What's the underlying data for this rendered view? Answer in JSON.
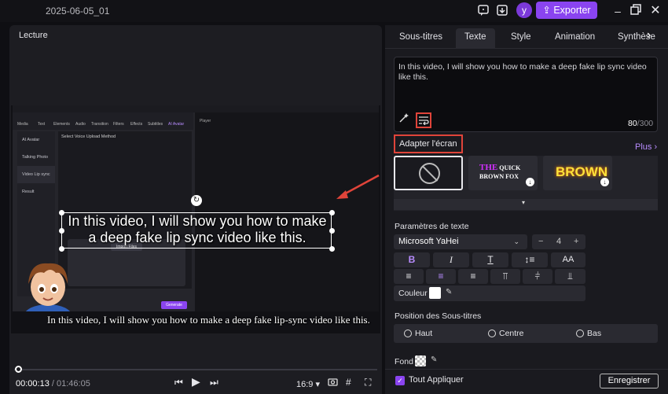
{
  "titlebar": {
    "date": "2025-06-05_01",
    "export_label": "Exporter",
    "avatar_letter": "y"
  },
  "left_panel": {
    "title": "Lecture"
  },
  "inner_app": {
    "toolbar_tabs": [
      "Media",
      "Text",
      "Elements",
      "Audio",
      "Transition",
      "Filters",
      "Effects",
      "Subtitles",
      "AI Avatar"
    ],
    "side_items": [
      "AI Avatar",
      "Talking Photo",
      "Video Lip sync",
      "Result"
    ],
    "section_title": "Select Voice Upload Method",
    "player_label": "Player",
    "import_label": "Import Files",
    "generate_label": "Generate"
  },
  "canvas": {
    "selected_text": "In this video, I will show you how to make a deep fake lip sync video like this.",
    "subtitle_text": "In this video, I will show you how to make a deep fake lip-sync video like this."
  },
  "playback": {
    "current_time": "00:00:13",
    "separator": " / ",
    "total_time": "01:46:05",
    "aspect_ratio": "16:9",
    "aspect_chevron": "▾",
    "progress": 0.01
  },
  "right_panel": {
    "tabs": [
      "Sous-titres",
      "Texte",
      "Style",
      "Animation",
      "Synthèse"
    ],
    "active_tab": "Texte",
    "text_value": "In this video, I will show you how to make a deep fake lip sync video like this.",
    "char_count": "80",
    "char_max": "/300",
    "fit_screen_label": "Adapter l'écran",
    "more_label": "Plus ›",
    "styles": [
      {
        "name": "none"
      },
      {
        "line1": "THE",
        "line1b": "QUICK",
        "line2": "BROWN FOX"
      },
      {
        "text": "BROWN"
      }
    ],
    "text_params_label": "Paramètres de texte",
    "font_name": "Microsoft YaHei",
    "font_size": "4",
    "color_label": "Couleur",
    "color_value": "#ffffff",
    "position_label": "Position des Sous-titres",
    "positions": [
      "Haut",
      "Centre",
      "Bas"
    ],
    "background_label": "Fond",
    "apply_all_label": "Tout Appliquer",
    "save_label": "Enregistrer"
  }
}
